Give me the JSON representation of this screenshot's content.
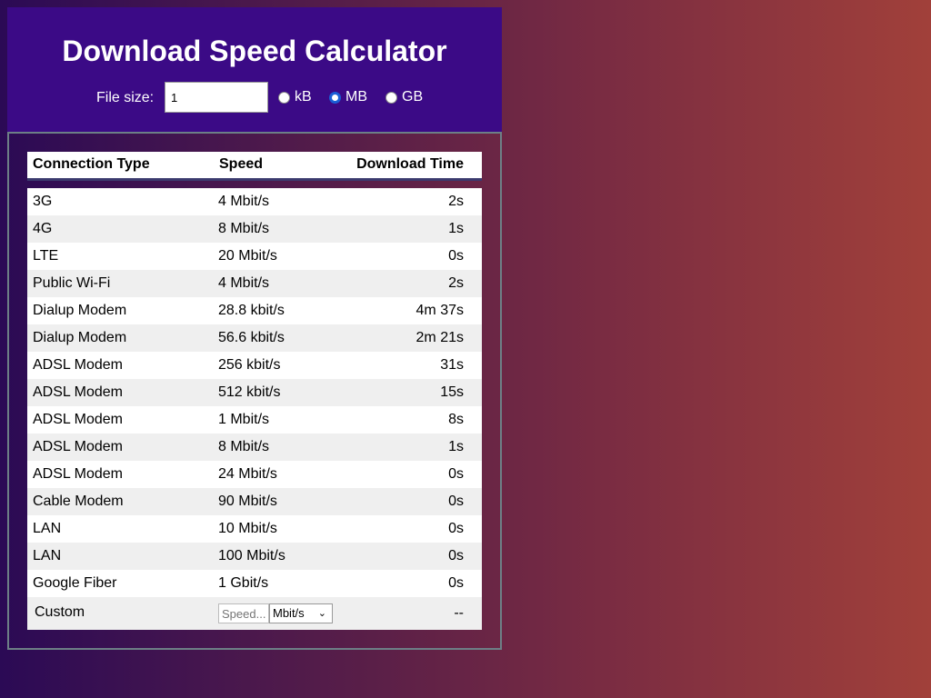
{
  "title": "Download Speed Calculator",
  "file_size": {
    "label": "File size:",
    "value": "1",
    "units": [
      {
        "label": "kB",
        "checked": false
      },
      {
        "label": "MB",
        "checked": true
      },
      {
        "label": "GB",
        "checked": false
      }
    ]
  },
  "table": {
    "headers": [
      "Connection Type",
      "Speed",
      "Download Time"
    ],
    "rows": [
      {
        "type": "3G",
        "speed": "4 Mbit/s",
        "time": "2s"
      },
      {
        "type": "4G",
        "speed": "8 Mbit/s",
        "time": "1s"
      },
      {
        "type": "LTE",
        "speed": "20 Mbit/s",
        "time": "0s"
      },
      {
        "type": "Public Wi-Fi",
        "speed": "4 Mbit/s",
        "time": "2s"
      },
      {
        "type": "Dialup Modem",
        "speed": "28.8 kbit/s",
        "time": "4m 37s"
      },
      {
        "type": "Dialup Modem",
        "speed": "56.6 kbit/s",
        "time": "2m 21s"
      },
      {
        "type": "ADSL Modem",
        "speed": "256 kbit/s",
        "time": "31s"
      },
      {
        "type": "ADSL Modem",
        "speed": "512 kbit/s",
        "time": "15s"
      },
      {
        "type": "ADSL Modem",
        "speed": "1 Mbit/s",
        "time": "8s"
      },
      {
        "type": "ADSL Modem",
        "speed": "8 Mbit/s",
        "time": "1s"
      },
      {
        "type": "ADSL Modem",
        "speed": "24 Mbit/s",
        "time": "0s"
      },
      {
        "type": "Cable Modem",
        "speed": "90 Mbit/s",
        "time": "0s"
      },
      {
        "type": "LAN",
        "speed": "10 Mbit/s",
        "time": "0s"
      },
      {
        "type": "LAN",
        "speed": "100 Mbit/s",
        "time": "0s"
      },
      {
        "type": "Google Fiber",
        "speed": "1 Gbit/s",
        "time": "0s"
      }
    ],
    "custom": {
      "label": "Custom",
      "speed_placeholder": "Speed...",
      "unit": "Mbit/s",
      "result": "--"
    }
  }
}
